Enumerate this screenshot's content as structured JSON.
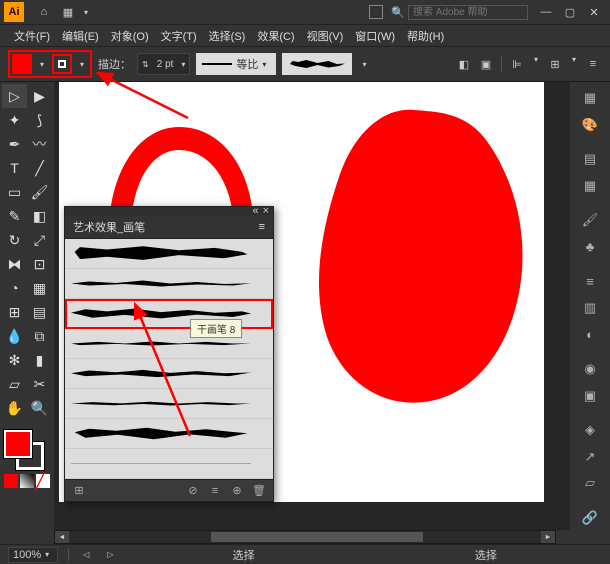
{
  "app": {
    "name": "Ai"
  },
  "search": {
    "placeholder": "搜索 Adobe 帮助"
  },
  "window_controls": {
    "min": "—",
    "max": "▢",
    "close": "✕"
  },
  "menu": [
    {
      "label": "文件(F)"
    },
    {
      "label": "编辑(E)"
    },
    {
      "label": "对象(O)"
    },
    {
      "label": "文字(T)"
    },
    {
      "label": "选择(S)"
    },
    {
      "label": "效果(C)"
    },
    {
      "label": "视图(V)"
    },
    {
      "label": "窗口(W)"
    },
    {
      "label": "帮助(H)"
    }
  ],
  "controlbar": {
    "stroke_label": "描边：",
    "stroke_width": "2 pt",
    "profile_label": "等比"
  },
  "colors": {
    "fill": "#ff0000",
    "accent_highlight": "#ff0000",
    "app_accent": "#ff9a00"
  },
  "brushes_panel": {
    "title": "艺术效果_画笔",
    "tooltip": "干画笔 8"
  },
  "statusbar": {
    "zoom": "100%",
    "info_left": "选择",
    "info_right": "选择"
  }
}
